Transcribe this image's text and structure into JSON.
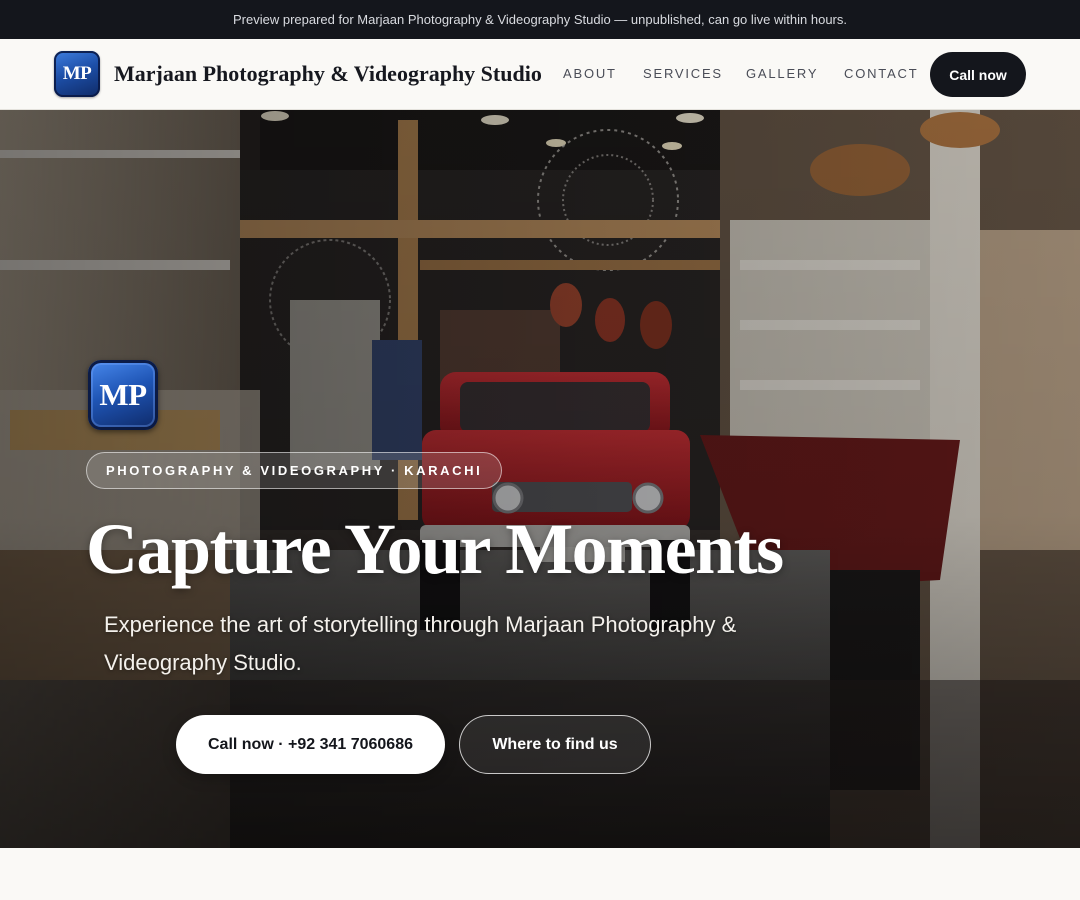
{
  "preview_bar": {
    "text": "Preview prepared for Marjaan Photography & Videography Studio — unpublished, can go live within hours."
  },
  "header": {
    "logo_text": "MP",
    "brand_name": "Marjaan Photography & Videography Studio",
    "nav": [
      "ABOUT",
      "SERVICES",
      "GALLERY",
      "CONTACT"
    ],
    "cta_label": "Call now"
  },
  "hero": {
    "logo_text": "MP",
    "eyebrow": "PHOTOGRAPHY & VIDEOGRAPHY · KARACHI",
    "title": "Capture Your Moments",
    "subtitle": "Experience the art of storytelling through Marjaan Photography & Videography Studio.",
    "primary_button": "Call now · +92 341 7060686",
    "secondary_button": "Where to find us"
  },
  "colors": {
    "dark": "#14161c",
    "page_background": "#faf9f6",
    "logo_blue": "#1d4fa8"
  }
}
